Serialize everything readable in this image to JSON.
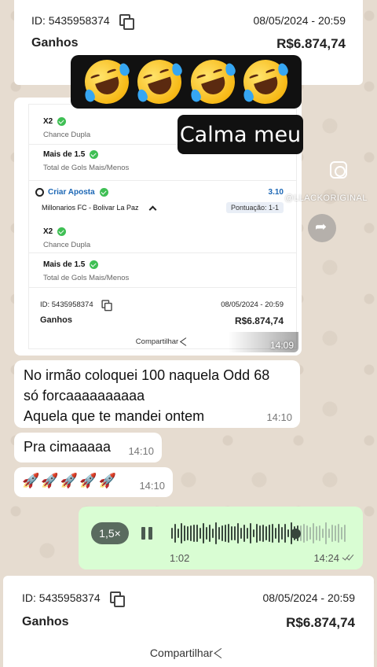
{
  "top_card": {
    "id_label": "ID: 5435958374",
    "date": "08/05/2024 - 20:59",
    "ganhos_label": "Ganhos",
    "amount": "R$6.874,74"
  },
  "caption_sticker": "Calma meu",
  "instagram_handle": "@LLACKORIGINAL",
  "image_message": {
    "selections": [
      {
        "title": "X2",
        "subtitle": "Chance Dupla"
      },
      {
        "title": "Mais de 1.5",
        "subtitle": "Total de Gols Mais/Menos"
      },
      {
        "title": "X2",
        "subtitle": "Chance Dupla"
      },
      {
        "title": "Mais de 1.5",
        "subtitle": "Total de Gols Mais/Menos"
      }
    ],
    "criar_aposta": "Criar Aposta",
    "odd": "3.10",
    "match": "Millonarios FC - Bolivar La Paz",
    "pontuacao": "Pontuação: 1-1",
    "id_label": "ID: 5435958374",
    "date": "08/05/2024 - 20:59",
    "ganhos_label": "Ganhos",
    "amount": "R$6.874,74",
    "share_label": "Compartilhar",
    "time": "14:09"
  },
  "messages": [
    {
      "text_lines": [
        "No irmão coloquei 100 naquela Odd 68",
        "só forcaaaaaaaaaa",
        "Aquela que te mandei ontem"
      ],
      "time": "14:10"
    },
    {
      "text": "Pra cimaaaaa",
      "time": "14:10"
    },
    {
      "text": "🚀🚀🚀🚀🚀",
      "time": "14:10"
    }
  ],
  "voice_note": {
    "speed": "1,5×",
    "duration": "1:02",
    "time": "14:24"
  },
  "bottom_card": {
    "id_label": "ID: 5435958374",
    "date": "08/05/2024 - 20:59",
    "ganhos_label": "Ganhos",
    "amount": "R$6.874,74",
    "share_label": "Compartilhar"
  },
  "colors": {
    "chat_bg": "#e6dcd0",
    "outgoing_bubble": "#d9fdd3",
    "check_green": "#3fbf54",
    "link_blue": "#1c67b5"
  }
}
